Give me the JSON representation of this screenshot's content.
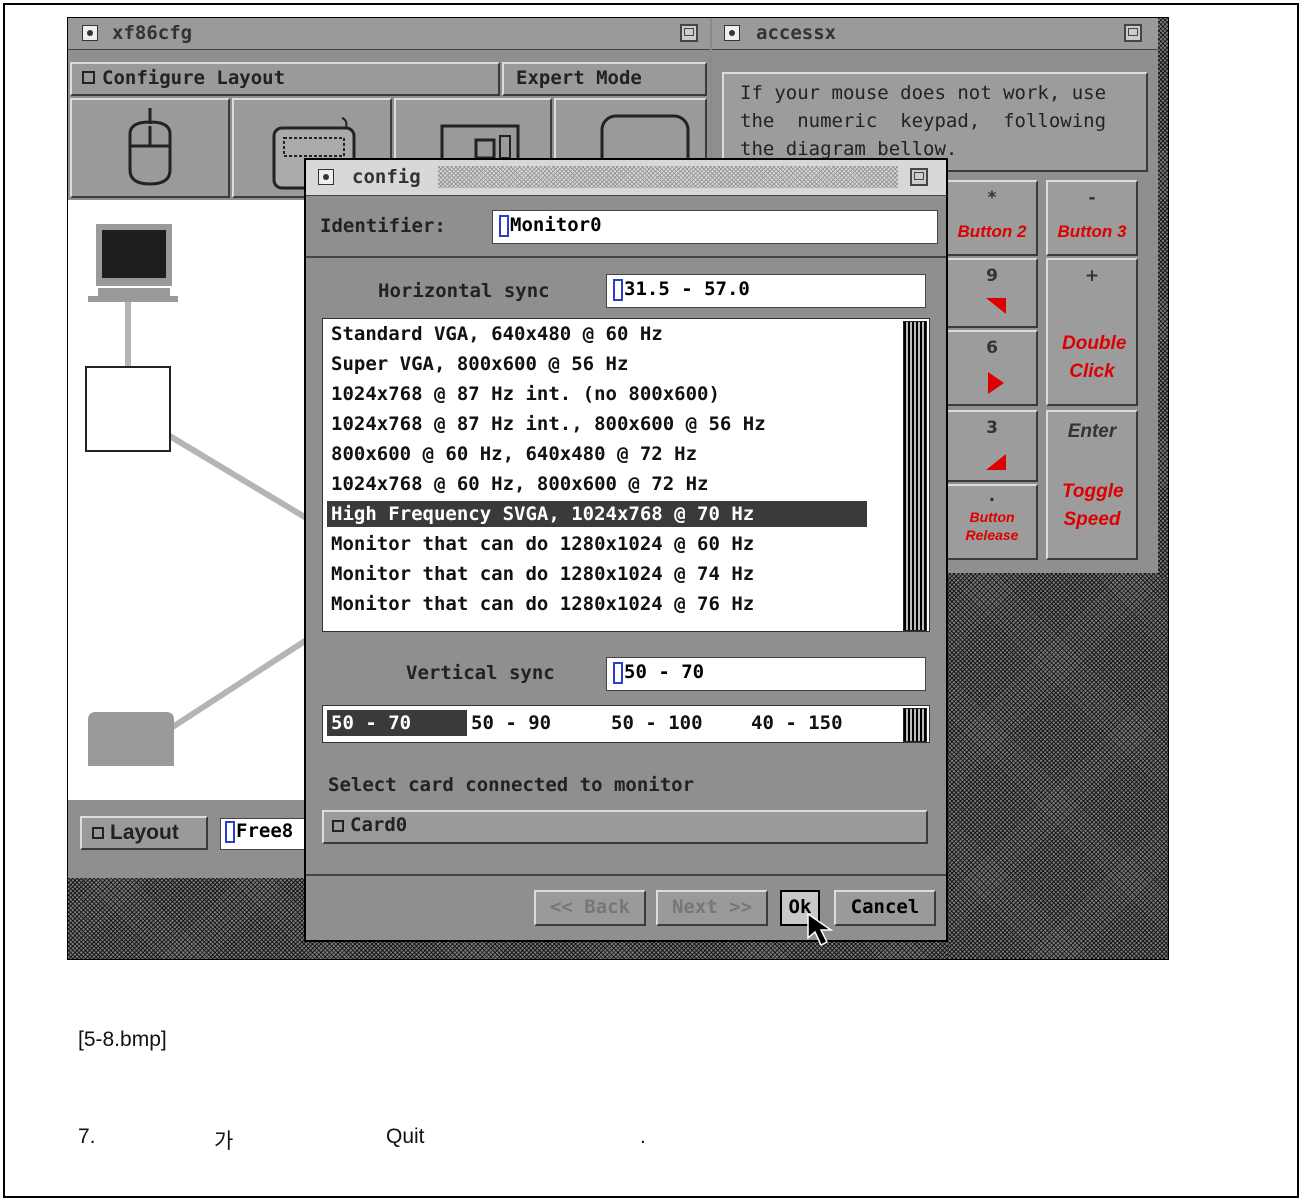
{
  "xf86cfg": {
    "title": "xf86cfg",
    "menu": {
      "configure": "Configure Layout",
      "expert": "Expert Mode"
    },
    "bottom": {
      "layout_btn": "Layout",
      "layout_field": "Free8"
    }
  },
  "accessx": {
    "title": "accessx",
    "help_lines": [
      "If your mouse does not work, use",
      "the  numeric  keypad,  following",
      "the diagram bellow."
    ],
    "keys": [
      {
        "sym": "*",
        "label": "Button 2"
      },
      {
        "sym": "-",
        "label": "Button 3"
      },
      {
        "sym": "9",
        "label": ""
      },
      {
        "sym": "+",
        "label": "Double Click"
      },
      {
        "sym": "6",
        "label": ""
      },
      {
        "sym": "3",
        "label": ""
      },
      {
        "sym": "",
        "label": "Enter"
      },
      {
        "sym": ".",
        "label": "Button Release"
      },
      {
        "sym": "",
        "label": "Toggle Speed"
      }
    ]
  },
  "config": {
    "title": "config",
    "identifier_label": "Identifier:",
    "identifier_value": "Monitor0",
    "hsync_label": "Horizontal sync",
    "hsync_value": "31.5 - 57.0",
    "monitors": [
      "Standard VGA, 640x480 @ 60 Hz",
      "Super VGA, 800x600 @ 56 Hz",
      "1024x768 @ 87 Hz int. (no 800x600)",
      "1024x768 @ 87 Hz int., 800x600 @ 56 Hz",
      "800x600 @ 60 Hz, 640x480 @ 72 Hz",
      "1024x768 @ 60 Hz, 800x600 @ 72 Hz",
      "High Frequency SVGA, 1024x768 @ 70 Hz",
      "Monitor that can do 1280x1024 @ 60 Hz",
      "Monitor that can do 1280x1024 @ 74 Hz",
      "Monitor that can do 1280x1024 @ 76 Hz"
    ],
    "selected_monitor_index": 6,
    "vsync_label": "Vertical sync",
    "vsync_value": "50 - 70",
    "vsync_options": [
      "50 - 70",
      "50 - 90",
      "50 - 100",
      "40 - 150"
    ],
    "selected_vsync_index": 0,
    "card_label": "Select card connected to monitor",
    "card_value": "Card0",
    "buttons": {
      "back": "<< Back",
      "next": "Next >>",
      "ok": "Ok",
      "cancel": "Cancel"
    }
  },
  "caption": {
    "filename": "[5-8.bmp]",
    "step_number": "7.",
    "step_char": "가",
    "step_word": "Quit",
    "step_end": "."
  },
  "colors": {
    "accent_red": "#dd0000",
    "selection": "#3a3a3a"
  }
}
